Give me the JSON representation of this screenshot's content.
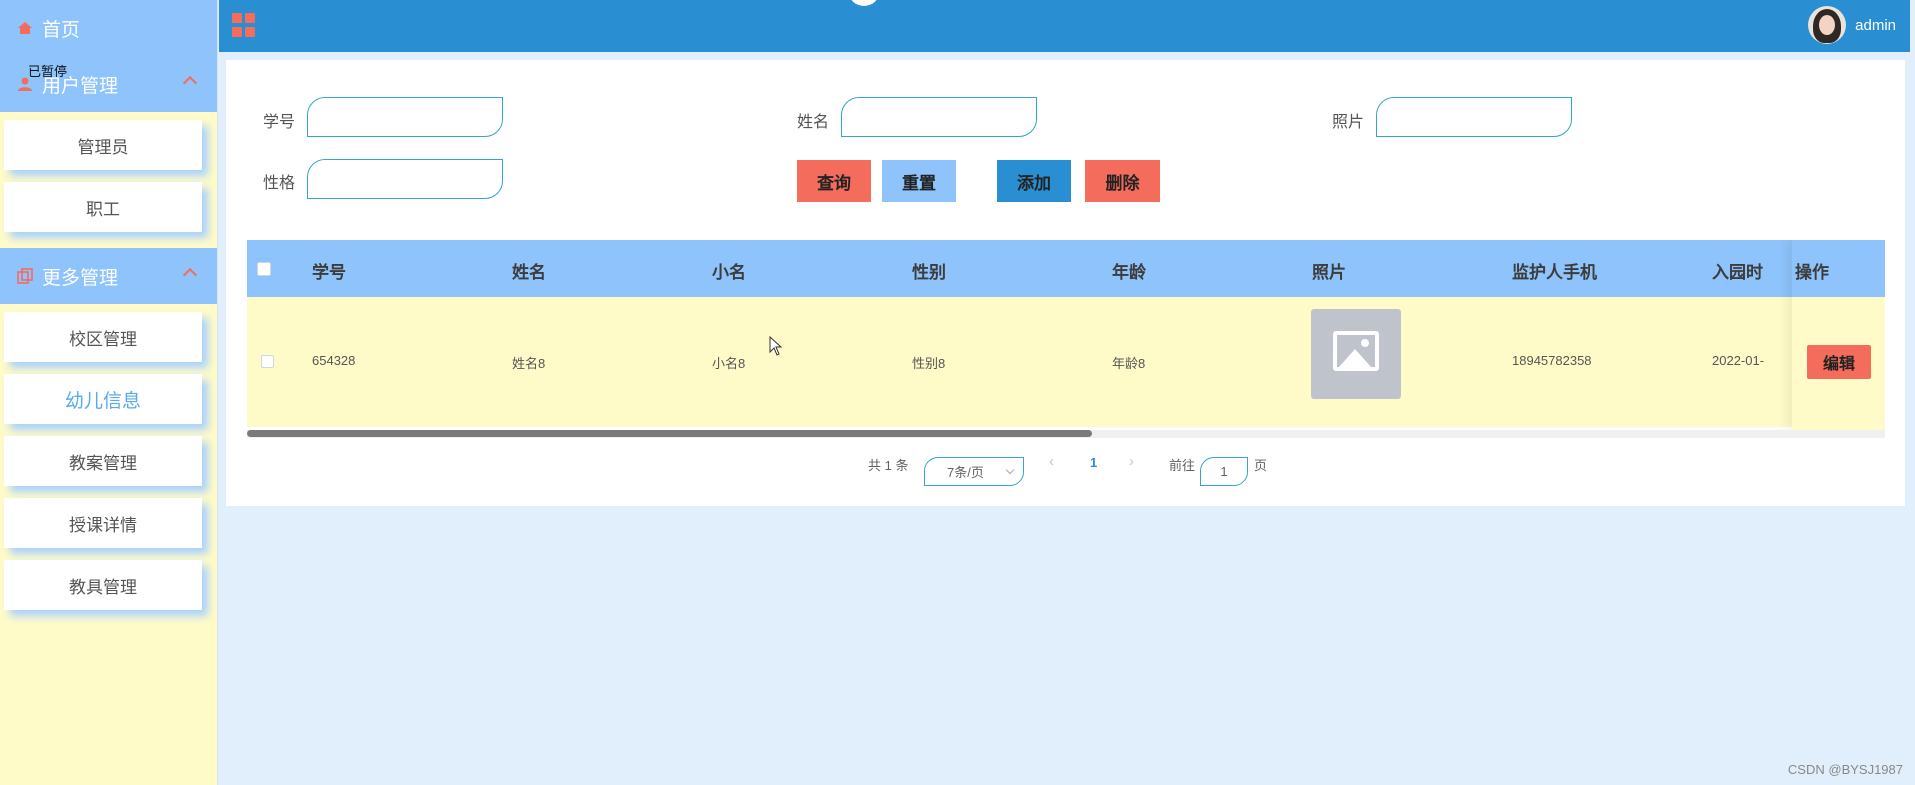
{
  "sidebar": {
    "home_label": "首页",
    "user_group_label": "用户管理",
    "tooltip": "已暂停",
    "user_items": [
      "管理员",
      "职工"
    ],
    "more_group_label": "更多管理",
    "more_items": [
      "校区管理",
      "幼儿信息",
      "教案管理",
      "授课详情",
      "教具管理"
    ],
    "active_item": "幼儿信息"
  },
  "header": {
    "username": "admin"
  },
  "search": {
    "labels": [
      "学号",
      "姓名",
      "照片",
      "性格"
    ]
  },
  "buttons": {
    "query": "查询",
    "reset": "重置",
    "add": "添加",
    "delete": "删除",
    "edit": "编辑"
  },
  "table": {
    "columns": [
      "学号",
      "姓名",
      "小名",
      "性别",
      "年龄",
      "照片",
      "监护人手机",
      "入园时",
      "操作"
    ],
    "rows": [
      [
        "654328",
        "姓名8",
        "小名8",
        "性别8",
        "年龄8",
        "",
        "18945782358",
        "2022-01-"
      ]
    ]
  },
  "pagination": {
    "total": "共 1 条",
    "page_size": "7条/页",
    "current_page": "1",
    "goto_label": "前往",
    "goto_value": "1",
    "page_suffix": "页"
  },
  "watermark": "CSDN @BYSJ1987",
  "colors": {
    "sidebar_bg": "#fffbc9",
    "menu_header_bg": "#8ec3fb",
    "topbar_bg": "#2a8fd2",
    "accent_red": "#f36c5c",
    "content_bg": "#e1effd"
  }
}
